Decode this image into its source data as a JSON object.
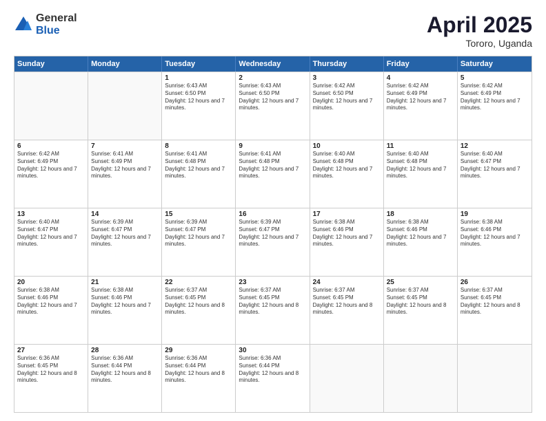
{
  "logo": {
    "general": "General",
    "blue": "Blue"
  },
  "header": {
    "month": "April 2025",
    "location": "Tororo, Uganda"
  },
  "weekdays": [
    "Sunday",
    "Monday",
    "Tuesday",
    "Wednesday",
    "Thursday",
    "Friday",
    "Saturday"
  ],
  "rows": [
    [
      {
        "day": "",
        "empty": true
      },
      {
        "day": "",
        "empty": true
      },
      {
        "day": "1",
        "sunrise": "Sunrise: 6:43 AM",
        "sunset": "Sunset: 6:50 PM",
        "daylight": "Daylight: 12 hours and 7 minutes."
      },
      {
        "day": "2",
        "sunrise": "Sunrise: 6:43 AM",
        "sunset": "Sunset: 6:50 PM",
        "daylight": "Daylight: 12 hours and 7 minutes."
      },
      {
        "day": "3",
        "sunrise": "Sunrise: 6:42 AM",
        "sunset": "Sunset: 6:50 PM",
        "daylight": "Daylight: 12 hours and 7 minutes."
      },
      {
        "day": "4",
        "sunrise": "Sunrise: 6:42 AM",
        "sunset": "Sunset: 6:49 PM",
        "daylight": "Daylight: 12 hours and 7 minutes."
      },
      {
        "day": "5",
        "sunrise": "Sunrise: 6:42 AM",
        "sunset": "Sunset: 6:49 PM",
        "daylight": "Daylight: 12 hours and 7 minutes."
      }
    ],
    [
      {
        "day": "6",
        "sunrise": "Sunrise: 6:42 AM",
        "sunset": "Sunset: 6:49 PM",
        "daylight": "Daylight: 12 hours and 7 minutes."
      },
      {
        "day": "7",
        "sunrise": "Sunrise: 6:41 AM",
        "sunset": "Sunset: 6:49 PM",
        "daylight": "Daylight: 12 hours and 7 minutes."
      },
      {
        "day": "8",
        "sunrise": "Sunrise: 6:41 AM",
        "sunset": "Sunset: 6:48 PM",
        "daylight": "Daylight: 12 hours and 7 minutes."
      },
      {
        "day": "9",
        "sunrise": "Sunrise: 6:41 AM",
        "sunset": "Sunset: 6:48 PM",
        "daylight": "Daylight: 12 hours and 7 minutes."
      },
      {
        "day": "10",
        "sunrise": "Sunrise: 6:40 AM",
        "sunset": "Sunset: 6:48 PM",
        "daylight": "Daylight: 12 hours and 7 minutes."
      },
      {
        "day": "11",
        "sunrise": "Sunrise: 6:40 AM",
        "sunset": "Sunset: 6:48 PM",
        "daylight": "Daylight: 12 hours and 7 minutes."
      },
      {
        "day": "12",
        "sunrise": "Sunrise: 6:40 AM",
        "sunset": "Sunset: 6:47 PM",
        "daylight": "Daylight: 12 hours and 7 minutes."
      }
    ],
    [
      {
        "day": "13",
        "sunrise": "Sunrise: 6:40 AM",
        "sunset": "Sunset: 6:47 PM",
        "daylight": "Daylight: 12 hours and 7 minutes."
      },
      {
        "day": "14",
        "sunrise": "Sunrise: 6:39 AM",
        "sunset": "Sunset: 6:47 PM",
        "daylight": "Daylight: 12 hours and 7 minutes."
      },
      {
        "day": "15",
        "sunrise": "Sunrise: 6:39 AM",
        "sunset": "Sunset: 6:47 PM",
        "daylight": "Daylight: 12 hours and 7 minutes."
      },
      {
        "day": "16",
        "sunrise": "Sunrise: 6:39 AM",
        "sunset": "Sunset: 6:47 PM",
        "daylight": "Daylight: 12 hours and 7 minutes."
      },
      {
        "day": "17",
        "sunrise": "Sunrise: 6:38 AM",
        "sunset": "Sunset: 6:46 PM",
        "daylight": "Daylight: 12 hours and 7 minutes."
      },
      {
        "day": "18",
        "sunrise": "Sunrise: 6:38 AM",
        "sunset": "Sunset: 6:46 PM",
        "daylight": "Daylight: 12 hours and 7 minutes."
      },
      {
        "day": "19",
        "sunrise": "Sunrise: 6:38 AM",
        "sunset": "Sunset: 6:46 PM",
        "daylight": "Daylight: 12 hours and 7 minutes."
      }
    ],
    [
      {
        "day": "20",
        "sunrise": "Sunrise: 6:38 AM",
        "sunset": "Sunset: 6:46 PM",
        "daylight": "Daylight: 12 hours and 7 minutes."
      },
      {
        "day": "21",
        "sunrise": "Sunrise: 6:38 AM",
        "sunset": "Sunset: 6:46 PM",
        "daylight": "Daylight: 12 hours and 7 minutes."
      },
      {
        "day": "22",
        "sunrise": "Sunrise: 6:37 AM",
        "sunset": "Sunset: 6:45 PM",
        "daylight": "Daylight: 12 hours and 8 minutes."
      },
      {
        "day": "23",
        "sunrise": "Sunrise: 6:37 AM",
        "sunset": "Sunset: 6:45 PM",
        "daylight": "Daylight: 12 hours and 8 minutes."
      },
      {
        "day": "24",
        "sunrise": "Sunrise: 6:37 AM",
        "sunset": "Sunset: 6:45 PM",
        "daylight": "Daylight: 12 hours and 8 minutes."
      },
      {
        "day": "25",
        "sunrise": "Sunrise: 6:37 AM",
        "sunset": "Sunset: 6:45 PM",
        "daylight": "Daylight: 12 hours and 8 minutes."
      },
      {
        "day": "26",
        "sunrise": "Sunrise: 6:37 AM",
        "sunset": "Sunset: 6:45 PM",
        "daylight": "Daylight: 12 hours and 8 minutes."
      }
    ],
    [
      {
        "day": "27",
        "sunrise": "Sunrise: 6:36 AM",
        "sunset": "Sunset: 6:45 PM",
        "daylight": "Daylight: 12 hours and 8 minutes."
      },
      {
        "day": "28",
        "sunrise": "Sunrise: 6:36 AM",
        "sunset": "Sunset: 6:44 PM",
        "daylight": "Daylight: 12 hours and 8 minutes."
      },
      {
        "day": "29",
        "sunrise": "Sunrise: 6:36 AM",
        "sunset": "Sunset: 6:44 PM",
        "daylight": "Daylight: 12 hours and 8 minutes."
      },
      {
        "day": "30",
        "sunrise": "Sunrise: 6:36 AM",
        "sunset": "Sunset: 6:44 PM",
        "daylight": "Daylight: 12 hours and 8 minutes."
      },
      {
        "day": "",
        "empty": true
      },
      {
        "day": "",
        "empty": true
      },
      {
        "day": "",
        "empty": true
      }
    ]
  ]
}
